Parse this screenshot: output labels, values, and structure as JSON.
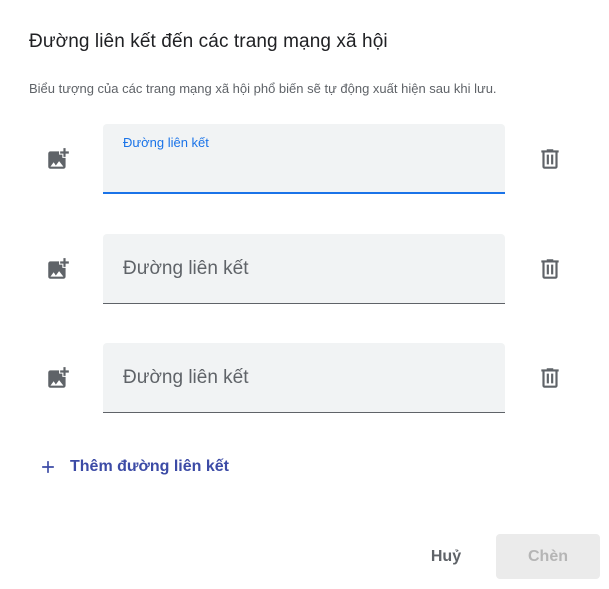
{
  "dialog": {
    "title": "Đường liên kết đến các trang mạng xã hội",
    "description": "Biểu tượng của các trang mạng xã hội phổ biến sẽ tự động xuất hiện sau khi lưu."
  },
  "rows": [
    {
      "float_label": "Đường liên kết",
      "value": "",
      "focused": true
    },
    {
      "placeholder": "Đường liên kết",
      "value": ""
    },
    {
      "placeholder": "Đường liên kết",
      "value": ""
    }
  ],
  "add_link_label": "Thêm đường liên kết",
  "actions": {
    "cancel_label": "Huỷ",
    "insert_label": "Chèn"
  },
  "colors": {
    "accent": "#1a73e8",
    "link": "#3c4ba6",
    "icon": "#5f6368",
    "field_bg": "#f1f3f4",
    "disabled_bg": "#ebebeb",
    "disabled_text": "#b5b5b5"
  },
  "icons": {
    "row_icon": "add-photo-icon",
    "delete_icon": "trash-icon",
    "add_icon": "plus-icon"
  }
}
